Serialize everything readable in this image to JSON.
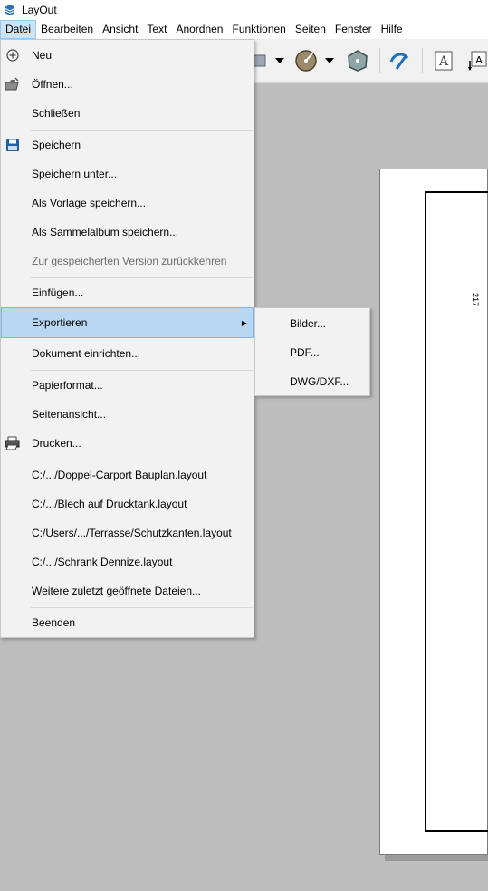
{
  "window": {
    "title": "LayOut"
  },
  "menubar": {
    "items": [
      {
        "label": "Datei",
        "active": true
      },
      {
        "label": "Bearbeiten"
      },
      {
        "label": "Ansicht"
      },
      {
        "label": "Text"
      },
      {
        "label": "Anordnen"
      },
      {
        "label": "Funktionen"
      },
      {
        "label": "Seiten"
      },
      {
        "label": "Fenster"
      },
      {
        "label": "Hilfe"
      }
    ]
  },
  "toolbar": {
    "icons": [
      "shape-tool-icon",
      "dropdown-arrow-icon",
      "pie-tool-icon",
      "dropdown-arrow-icon",
      "polygon-tool-icon",
      "style-tool-icon",
      "text-tool-icon",
      "label-tool-icon"
    ]
  },
  "file_menu": {
    "items": [
      {
        "label": "Neu",
        "icon": "new-document-icon"
      },
      {
        "label": "Öffnen...",
        "icon": "open-folder-icon"
      },
      {
        "label": "Schließen"
      },
      {
        "label": "Speichern",
        "icon": "save-disk-icon"
      },
      {
        "label": "Speichern unter..."
      },
      {
        "label": "Als Vorlage speichern..."
      },
      {
        "label": "Als Sammelalbum speichern..."
      },
      {
        "label": "Zur gespeicherten Version zurückkehren",
        "disabled": true
      },
      {
        "label": "Einfügen..."
      },
      {
        "label": "Exportieren",
        "has_submenu": true,
        "highlighted": true
      },
      {
        "label": "Dokument einrichten..."
      },
      {
        "label": "Papierformat..."
      },
      {
        "label": "Seitenansicht..."
      },
      {
        "label": "Drucken...",
        "icon": "printer-icon"
      },
      {
        "label": "C:/.../Doppel-Carport Bauplan.layout"
      },
      {
        "label": "C:/.../Blech auf Drucktank.layout"
      },
      {
        "label": "C:/Users/.../Terrasse/Schutzkanten.layout"
      },
      {
        "label": "C:/.../Schrank Dennize.layout"
      },
      {
        "label": "Weitere zuletzt geöffnete Dateien..."
      },
      {
        "label": "Beenden"
      }
    ]
  },
  "export_submenu": {
    "items": [
      {
        "label": "Bilder..."
      },
      {
        "label": "PDF..."
      },
      {
        "label": "DWG/DXF..."
      }
    ]
  },
  "document": {
    "frame_label": "217"
  },
  "colors": {
    "menu_highlight": "#b8d7f3",
    "menubar_active": "#cce4f7",
    "canvas_background": "#bdbdbd",
    "disabled_text": "#6d6d6d"
  }
}
